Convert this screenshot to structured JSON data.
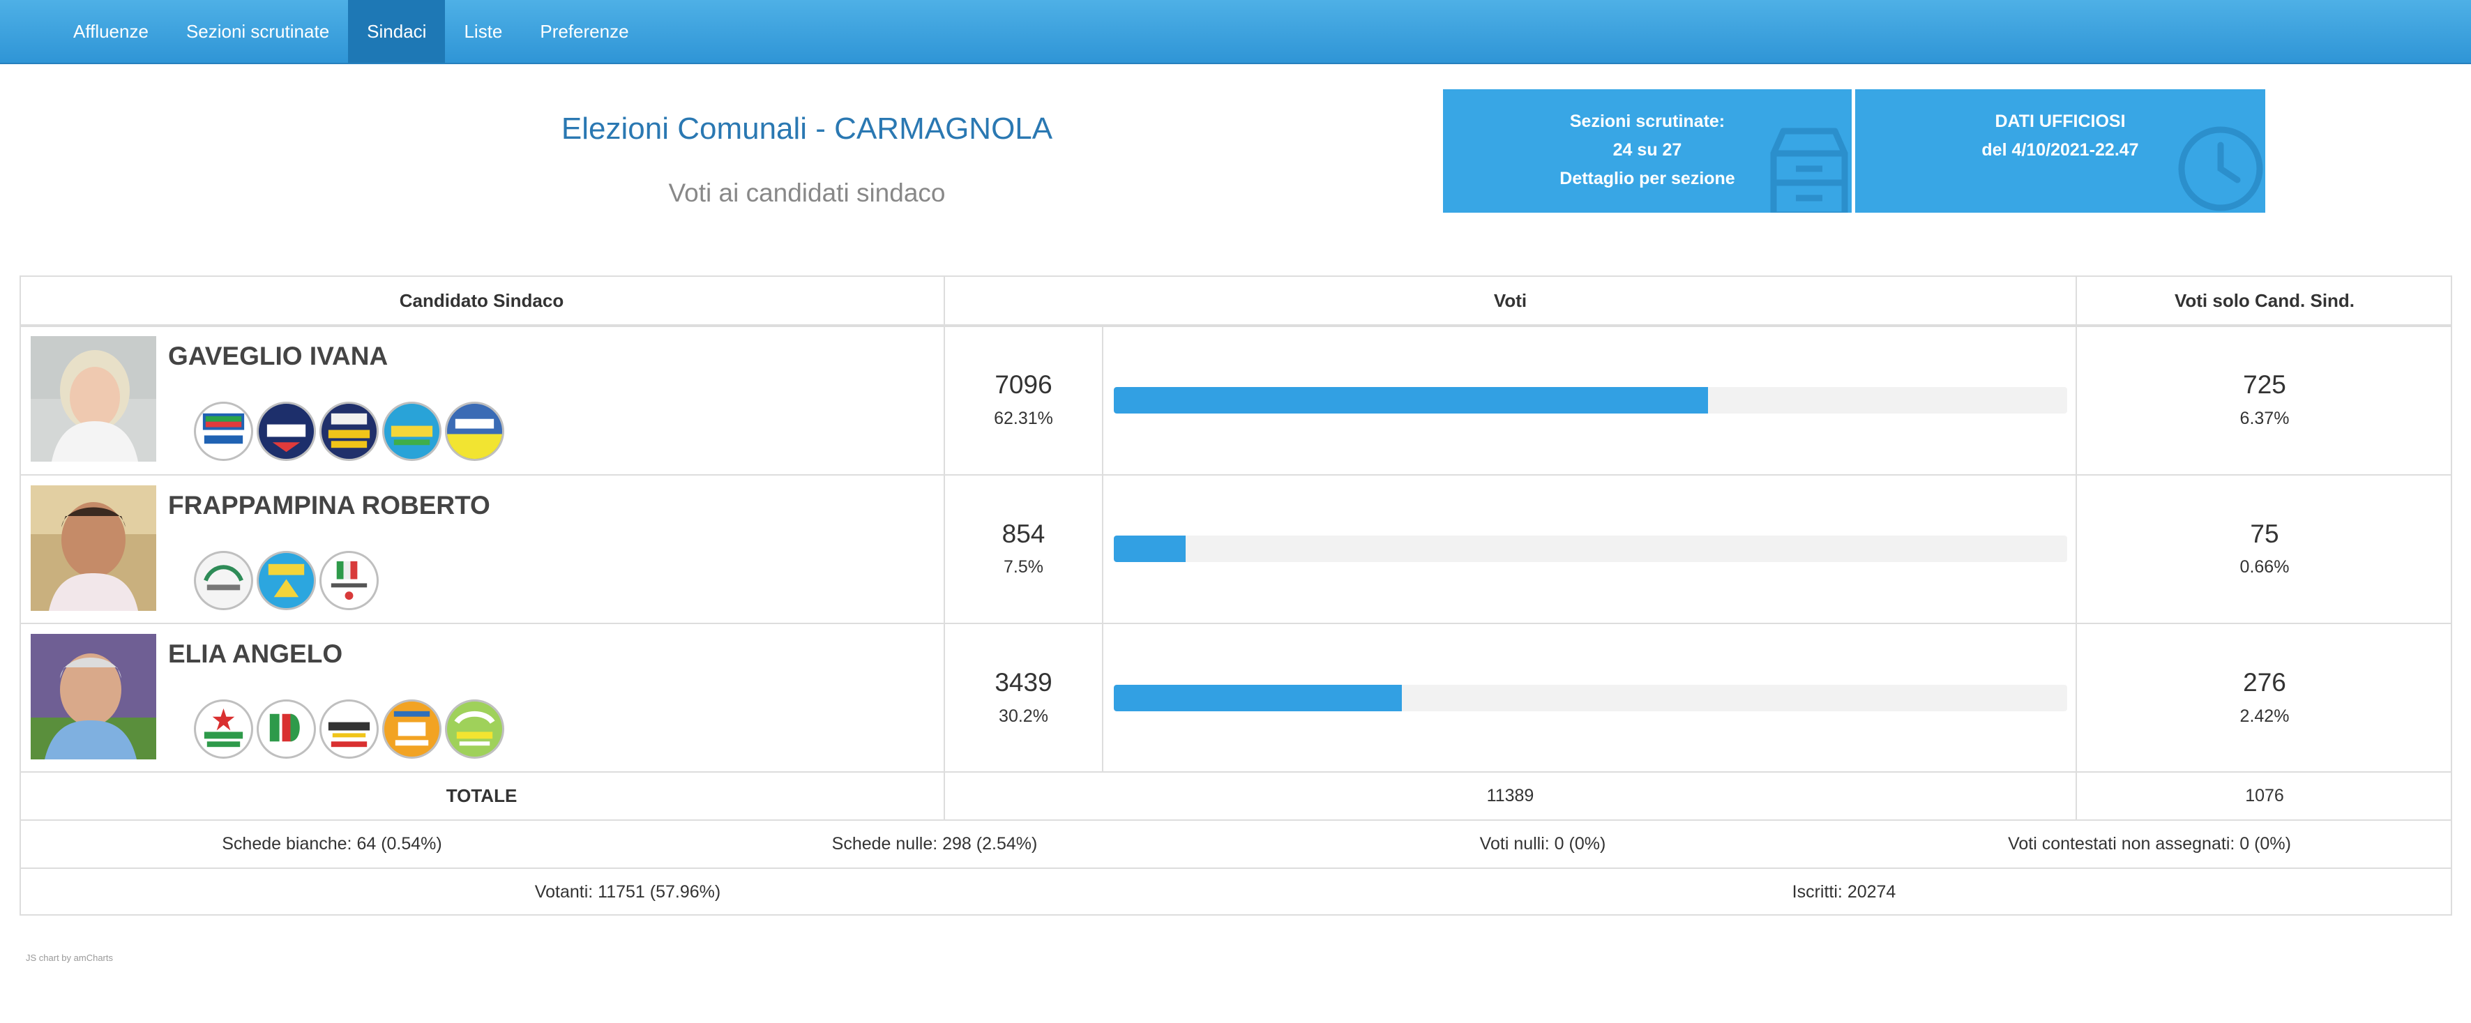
{
  "nav": {
    "items": [
      {
        "label": "Affluenze",
        "active": false
      },
      {
        "label": "Sezioni scrutinate",
        "active": false
      },
      {
        "label": "Sindaci",
        "active": true
      },
      {
        "label": "Liste",
        "active": false
      },
      {
        "label": "Preferenze",
        "active": false
      }
    ]
  },
  "header": {
    "title": "Elezioni Comunali - CARMAGNOLA",
    "subtitle": "Voti ai candidati sindaco"
  },
  "sections_box": {
    "line1": "Sezioni scrutinate:",
    "line2": "24 su 27",
    "line3": "Dettaglio per sezione",
    "icon": "archive-box-icon"
  },
  "official_box": {
    "line1": "DATI UFFICIOSI",
    "line2": "del 4/10/2021-22.47",
    "icon": "clock-icon"
  },
  "table": {
    "headers": {
      "candidate": "Candidato Sindaco",
      "votes": "Voti",
      "only_candidate": "Voti solo Cand. Sind."
    },
    "candidates": [
      {
        "name": "GAVEGLIO IVANA",
        "votes": "7096",
        "percent": "62.31%",
        "share": 0.6231,
        "only_votes": "725",
        "only_percent": "6.37%",
        "logo_count": 5
      },
      {
        "name": "FRAPPAMPINA ROBERTO",
        "votes": "854",
        "percent": "7.5%",
        "share": 0.075,
        "only_votes": "75",
        "only_percent": "0.66%",
        "logo_count": 3
      },
      {
        "name": "ELIA ANGELO",
        "votes": "3439",
        "percent": "30.2%",
        "share": 0.302,
        "only_votes": "276",
        "only_percent": "2.42%",
        "logo_count": 5
      }
    ],
    "total": {
      "label": "TOTALE",
      "votes": "11389",
      "only_votes": "1076"
    },
    "stats": {
      "blank": "Schede bianche: 64 (0.54%)",
      "null_ballots": "Schede nulle: 298 (2.54%)",
      "null_votes": "Voti nulli: 0 (0%)",
      "contested": "Voti contestati non assegnati: 0 (0%)",
      "voters": "Votanti: 11751 (57.96%)",
      "registered": "Iscritti: 20274"
    }
  },
  "credit": "JS chart by amCharts",
  "colors": {
    "navbar": "#3aa0de",
    "nav_active": "#1e78b5",
    "info_box": "#38a6e5",
    "bar": "#32a0e3",
    "title": "#2a78b2"
  }
}
